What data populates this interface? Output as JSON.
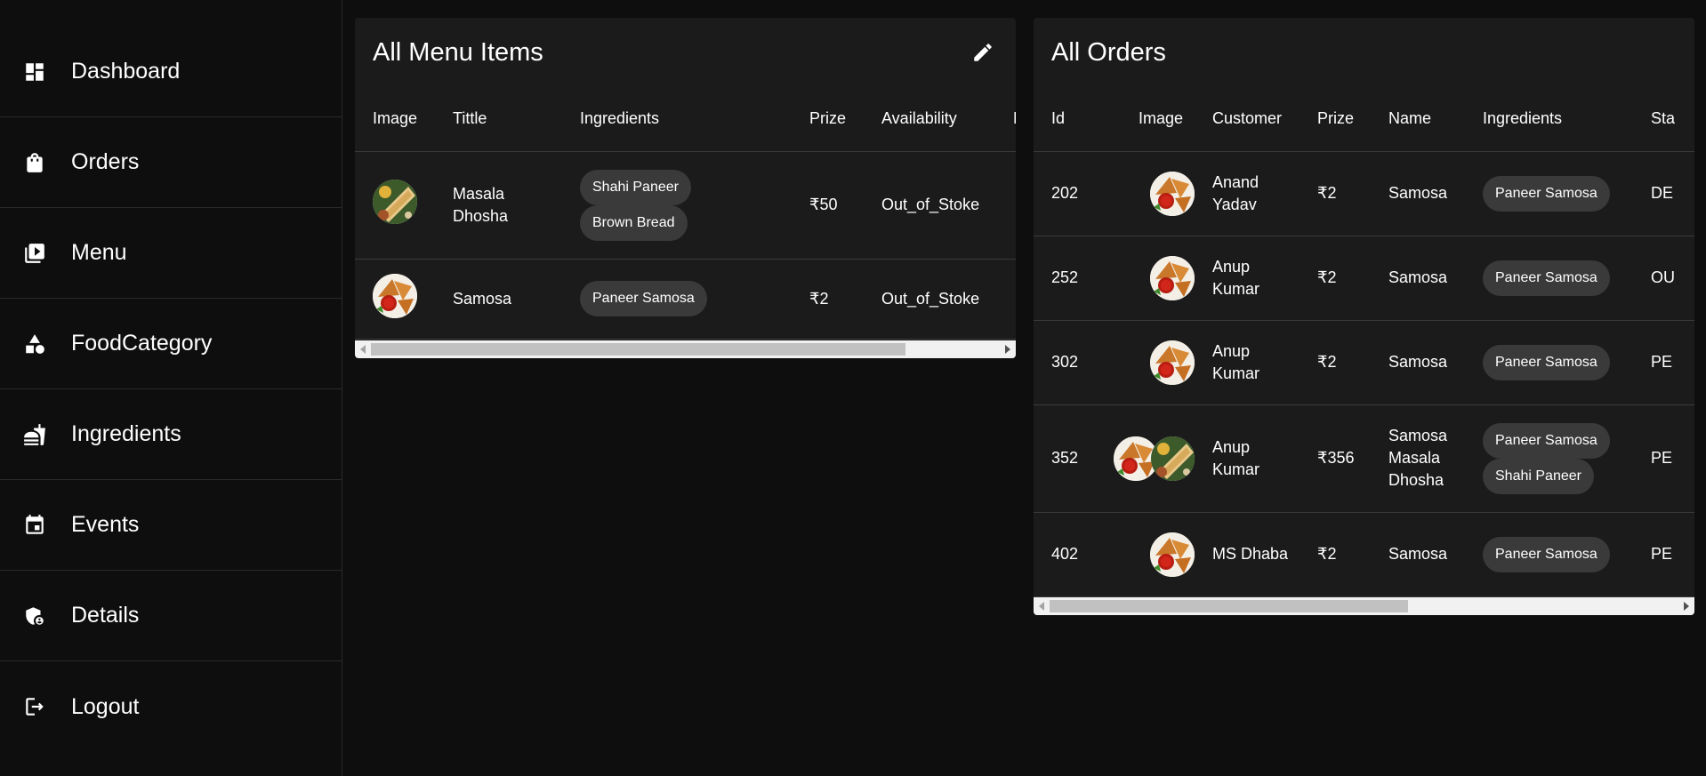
{
  "sidebar": {
    "items": [
      {
        "label": "Dashboard",
        "icon": "dashboard-icon"
      },
      {
        "label": "Orders",
        "icon": "shopping-bag-icon"
      },
      {
        "label": "Menu",
        "icon": "video-library-icon"
      },
      {
        "label": "FoodCategory",
        "icon": "category-icon"
      },
      {
        "label": "Ingredients",
        "icon": "fastfood-icon"
      },
      {
        "label": "Events",
        "icon": "event-icon"
      },
      {
        "label": "Details",
        "icon": "admin-panel-settings-icon"
      },
      {
        "label": "Logout",
        "icon": "logout-icon"
      }
    ]
  },
  "menu_panel": {
    "title": "All Menu Items",
    "edit_icon": "edit-icon",
    "columns": [
      "Image",
      "Tittle",
      "Ingredients",
      "Prize",
      "Availability",
      "D"
    ],
    "rows": [
      {
        "image": "masala-dosa-image",
        "title": "Masala Dhosha",
        "ingredients": [
          "Shahi Paneer",
          "Brown Bread"
        ],
        "prize": "₹50",
        "availability": "Out_of_Stoke"
      },
      {
        "image": "samosa-image",
        "title": "Samosa",
        "ingredients": [
          "Paneer Samosa"
        ],
        "prize": "₹2",
        "availability": "Out_of_Stoke"
      }
    ],
    "scroll_fraction": 0.85
  },
  "orders_panel": {
    "title": "All Orders",
    "columns": [
      "Id",
      "Image",
      "Customer",
      "Prize",
      "Name",
      "Ingredients",
      "Sta"
    ],
    "rows": [
      {
        "id": "202",
        "images": [
          "samosa-image"
        ],
        "customer": "Anand Yadav",
        "prize": "₹2",
        "name": "Samosa",
        "ingredients": [
          "Paneer Samosa"
        ],
        "status": "DE"
      },
      {
        "id": "252",
        "images": [
          "samosa-image"
        ],
        "customer": "Anup Kumar",
        "prize": "₹2",
        "name": "Samosa",
        "ingredients": [
          "Paneer Samosa"
        ],
        "status": "OU"
      },
      {
        "id": "302",
        "images": [
          "samosa-image"
        ],
        "customer": "Anup Kumar",
        "prize": "₹2",
        "name": "Samosa",
        "ingredients": [
          "Paneer Samosa"
        ],
        "status": "PE"
      },
      {
        "id": "352",
        "images": [
          "samosa-image",
          "masala-dosa-image"
        ],
        "customer": "Anup Kumar",
        "prize": "₹356",
        "name": "Samosa Masala Dhosha",
        "ingredients": [
          "Paneer Samosa",
          "Shahi Paneer"
        ],
        "status": "PE"
      },
      {
        "id": "402",
        "images": [
          "samosa-image"
        ],
        "customer": "MS Dhaba",
        "prize": "₹2",
        "name": "Samosa",
        "ingredients": [
          "Paneer Samosa"
        ],
        "status": "PE"
      }
    ],
    "scroll_fraction": 0.57
  }
}
